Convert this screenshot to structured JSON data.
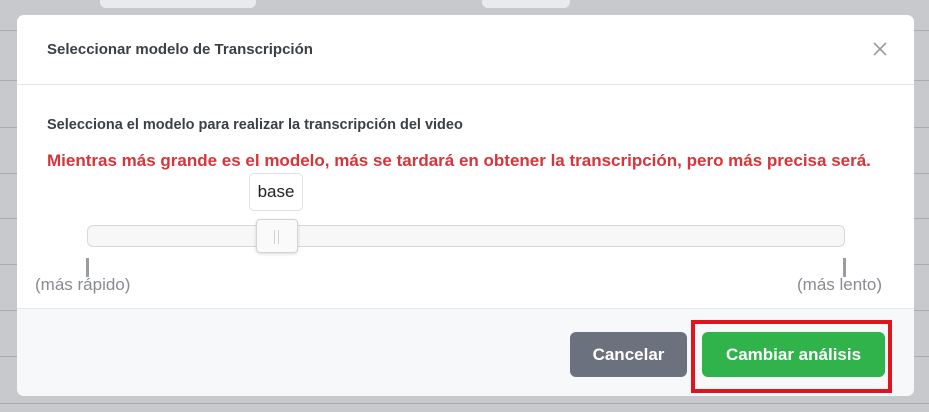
{
  "modal": {
    "title": "Seleccionar modelo de Transcripción",
    "description": "Selecciona el modelo para realizar la transcripción del video",
    "warning": "Mientras más grande es el modelo, más se tardará en obtener la transcripción, pero más precisa será.",
    "close_icon": "close-icon"
  },
  "slider": {
    "selected_value": "base",
    "min_label": "(más rápido)",
    "max_label": "(más lento)",
    "value_fraction": 0.24
  },
  "footer": {
    "cancel_label": "Cancelar",
    "confirm_label": "Cambiar análisis"
  },
  "colors": {
    "warning": "#d9343a",
    "cancel_button": "#6b727d",
    "confirm_button": "#2fb34a",
    "highlight": "#e0141c"
  }
}
